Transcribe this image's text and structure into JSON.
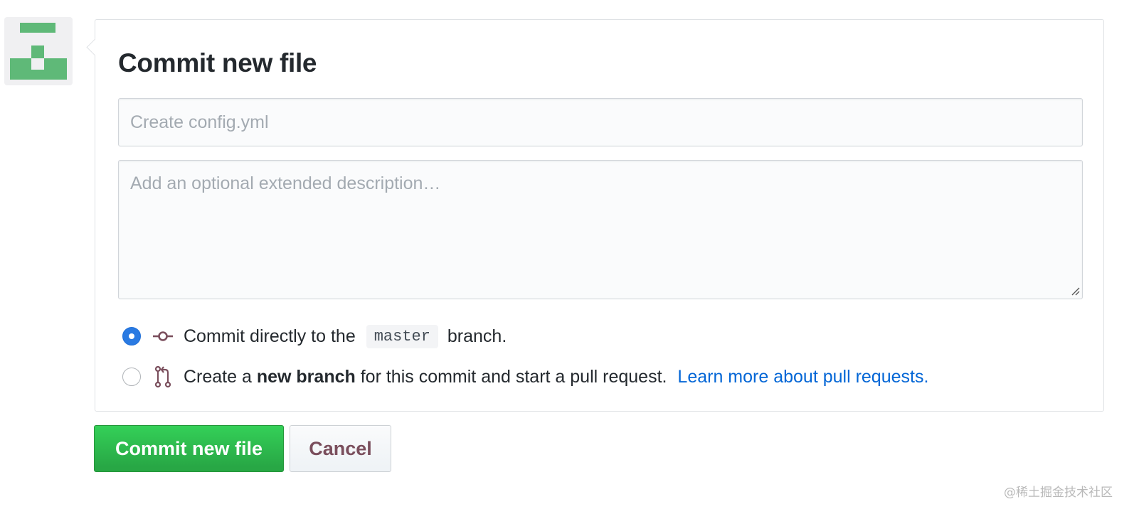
{
  "avatar": {
    "icon": "identicon",
    "color": "#5fb978"
  },
  "panel": {
    "title": "Commit new file",
    "summary_placeholder": "Create config.yml",
    "summary_value": "",
    "description_placeholder": "Add an optional extended description…",
    "description_value": "",
    "options": [
      {
        "selected": true,
        "icon": "git-commit-icon",
        "text_before": "Commit directly to the",
        "branch": "master",
        "text_after": "branch."
      },
      {
        "selected": false,
        "icon": "git-pull-request-icon",
        "text_before": "Create a",
        "bold": "new branch",
        "text_after": "for this commit and start a pull request.",
        "link": "Learn more about pull requests."
      }
    ]
  },
  "buttons": {
    "commit_label": "Commit new file",
    "cancel_label": "Cancel"
  },
  "colors": {
    "accent": "#2a7ae2",
    "primary_button": "#28a745",
    "link": "#0366d6"
  },
  "watermark": "@稀土掘金技术社区"
}
